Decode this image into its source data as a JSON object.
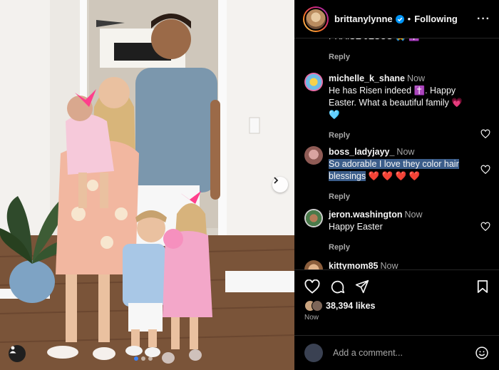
{
  "header": {
    "username": "brittanylynne",
    "separator": "•",
    "follow_status": "Following",
    "more_label": "···"
  },
  "comments": [
    {
      "user": "",
      "time": "",
      "text": "PRAISE JESUS 🙏 ✝️",
      "reply_label": "Reply"
    },
    {
      "user": "michelle_k_shane",
      "time": "Now",
      "text": "He has Risen indeed ✝️. Happy Easter. What a beautiful family 💗 🩵",
      "reply_label": "Reply"
    },
    {
      "user": "boss_ladyjayy_",
      "time": "Now",
      "text_selected": "So adorable I love they color hair blessings",
      "text_rest": " ❤️ ❤️ ❤️ ❤️",
      "reply_label": "Reply"
    },
    {
      "user": "jeron.washington",
      "time": "Now",
      "text": "Happy Easter",
      "reply_label": "Reply"
    },
    {
      "user": "kittymom85",
      "time": "Now",
      "text": "",
      "reply_label": ""
    }
  ],
  "post": {
    "likes": "38,394 likes",
    "posted": "Now"
  },
  "composer": {
    "placeholder": "Add a comment..."
  },
  "colors": {
    "accent": "#0095f6",
    "selection": "#3b5d8a",
    "muted_text": "#a8a8a8"
  }
}
